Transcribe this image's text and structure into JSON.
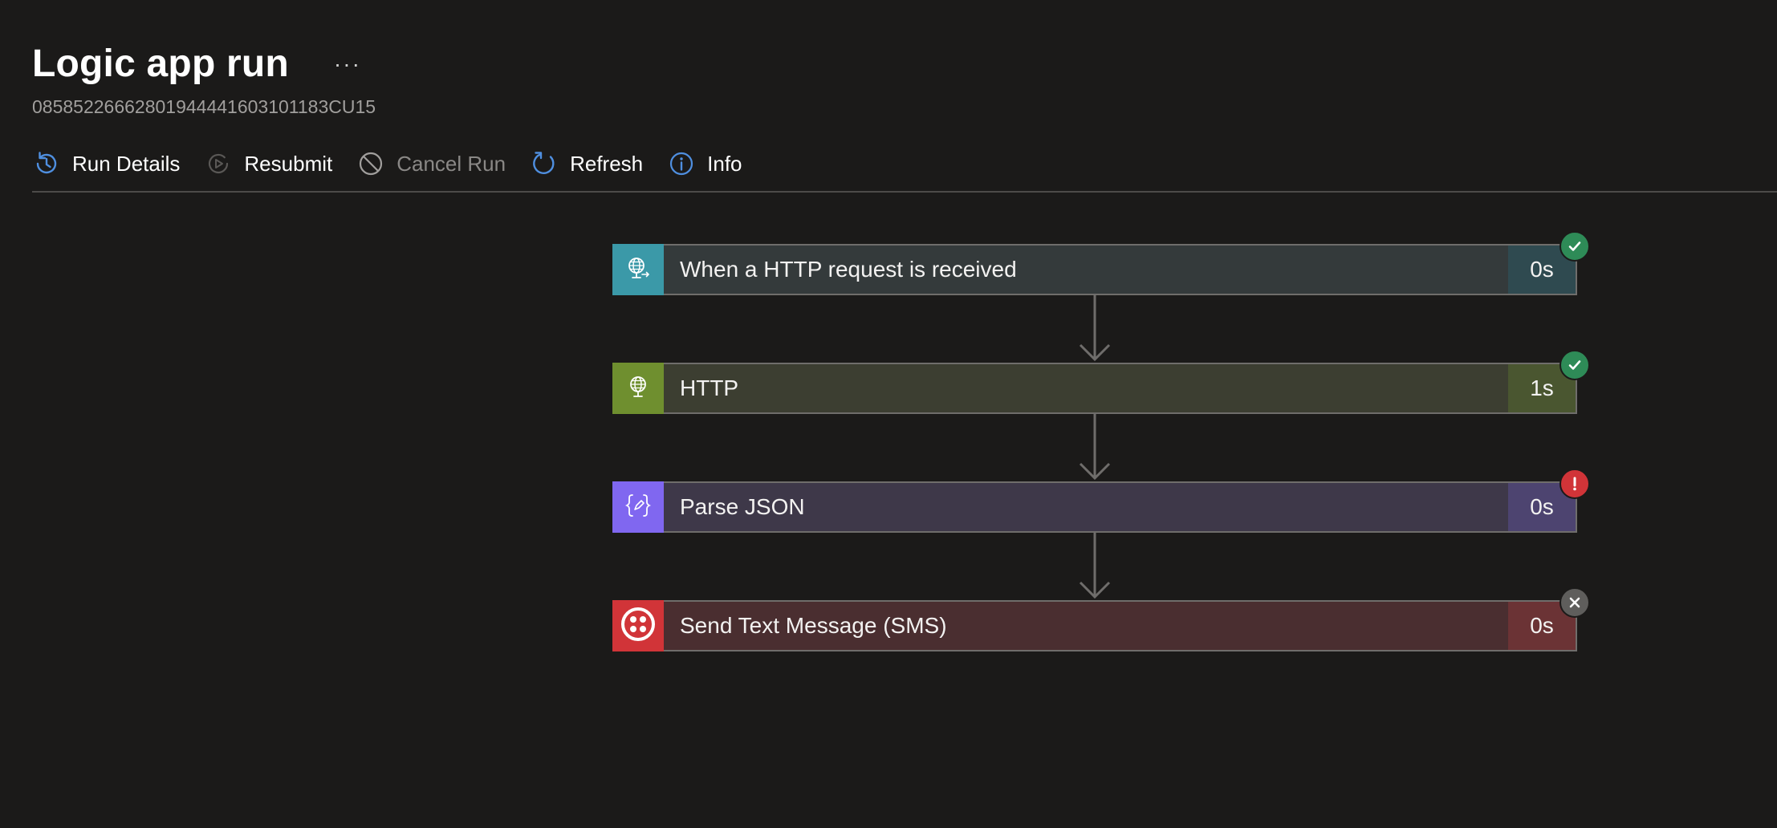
{
  "header": {
    "title": "Logic app run",
    "more": "···",
    "run_id": "08585226662801944441603101183CU15"
  },
  "toolbar": {
    "run_details": "Run Details",
    "resubmit": "Resubmit",
    "cancel_run": "Cancel Run",
    "refresh": "Refresh",
    "info": "Info"
  },
  "steps": [
    {
      "label": "When a HTTP request is received",
      "duration": "0s",
      "status": "succeeded",
      "icon": "http-request-icon",
      "accent": "#3b99a8",
      "body": "#343a3b",
      "dur_bg": "#2f4a50"
    },
    {
      "label": "HTTP",
      "duration": "1s",
      "status": "succeeded",
      "icon": "globe-icon",
      "accent": "#6f8f2f",
      "body": "#3c3e31",
      "dur_bg": "#4a5630"
    },
    {
      "label": "Parse JSON",
      "duration": "0s",
      "status": "failed",
      "icon": "json-braces-icon",
      "accent": "#8067f0",
      "body": "#3e3849",
      "dur_bg": "#4d4470"
    },
    {
      "label": "Send Text Message (SMS)",
      "duration": "0s",
      "status": "skipped",
      "icon": "twilio-icon",
      "accent": "#d13438",
      "body": "#4a2e30",
      "dur_bg": "#6b3335"
    }
  ],
  "colors": {
    "accent_blue": "#4f8fe0",
    "success": "#2e8b57",
    "error": "#d13438",
    "skipped": "#5f5e5c"
  }
}
